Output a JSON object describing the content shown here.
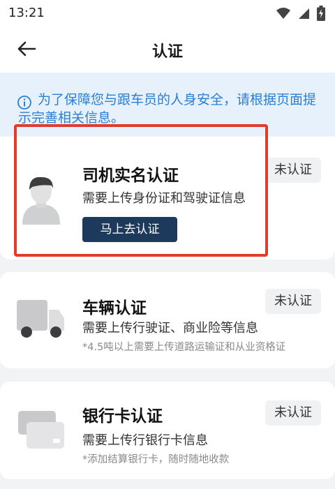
{
  "status_bar": {
    "time": "13:21",
    "icons": [
      "wifi-icon",
      "signal-icon",
      "battery-charging-icon"
    ]
  },
  "header": {
    "title": "认证",
    "back_icon": "arrow-left-icon"
  },
  "notice": {
    "icon": "info-icon",
    "text_line1": "为了保障您与跟车员的人身安全，请根据页面提",
    "text_line2": "示完善相关信息。",
    "color": "#2a7fd4"
  },
  "cards": [
    {
      "title": "司机实名认证",
      "description": "需要上传身份证和驾驶证信息",
      "status": "未认证",
      "button_label": "马上去认证",
      "icon": "driver-avatar-icon"
    },
    {
      "title": "车辆认证",
      "description": "需要上传行驶证、商业险等信息",
      "note": "*4.5吨以上需要上传道路运输证和从业资格证",
      "status": "未认证",
      "icon": "truck-icon"
    },
    {
      "title": "银行卡认证",
      "description": "需要上传行银行卡信息",
      "note": "*添加结算银行卡，随时随地收款",
      "status": "未认证",
      "icon": "bank-card-icon"
    }
  ],
  "colors": {
    "accent_button": "#1d3a5c",
    "highlight_border": "#e33b2b",
    "notice_bg": "#e6f1fb"
  }
}
